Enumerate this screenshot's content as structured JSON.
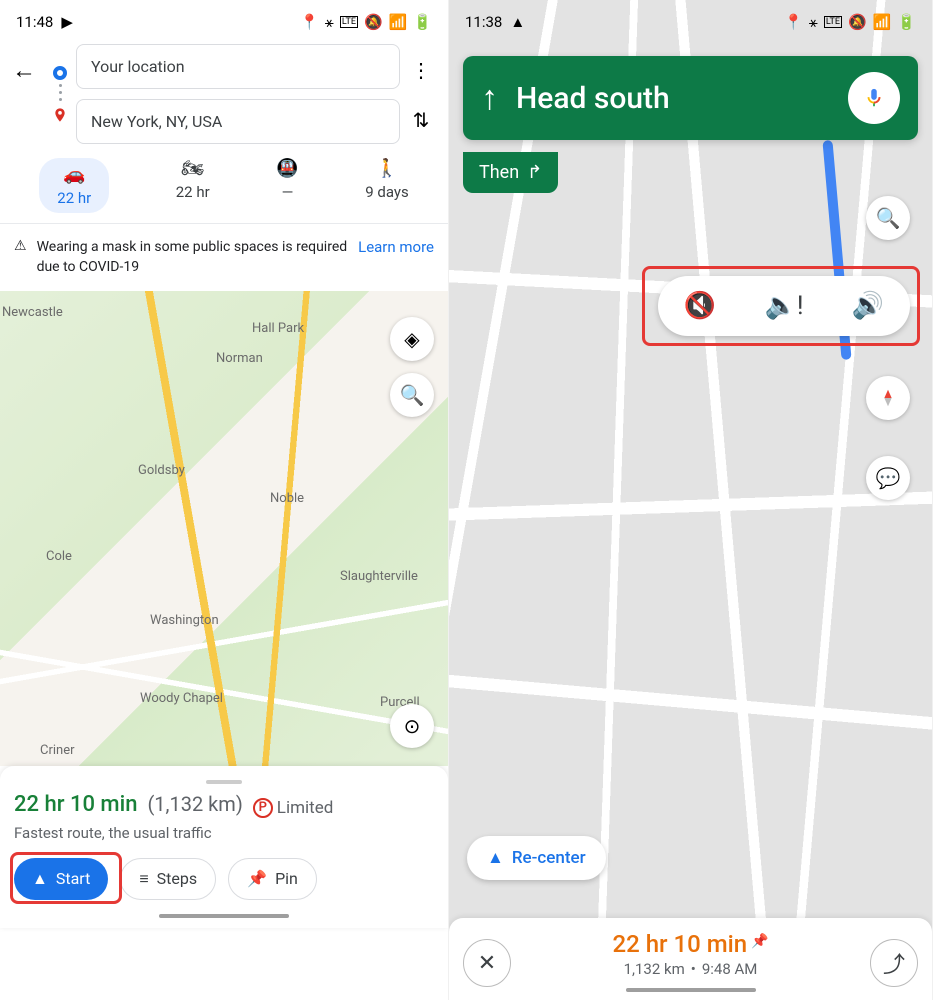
{
  "left": {
    "status": {
      "time": "11:48"
    },
    "origin": "Your location",
    "destination": "New York, NY, USA",
    "modes": {
      "car": "22 hr",
      "moto": "22 hr",
      "transit": "—",
      "walk": "9 days"
    },
    "alert": {
      "text": "Wearing a mask in some public spaces is required due to COVID-19",
      "link": "Learn more"
    },
    "map_labels": {
      "l1": "Newcastle",
      "l2": "Hall Park",
      "l3": "Norman",
      "l4": "Goldsby",
      "l5": "Noble",
      "l6": "Cole",
      "l7": "Slaughterville",
      "l8": "Washington",
      "l9": "Woody Chapel",
      "l10": "Purcell",
      "l11": "Criner"
    },
    "route": {
      "duration": "22 hr 10 min",
      "distance": "(1,132 km)",
      "parking_label": "Limited",
      "note": "Fastest route, the usual traffic"
    },
    "buttons": {
      "start": "Start",
      "steps": "Steps",
      "pin": "Pin"
    }
  },
  "right": {
    "status": {
      "time": "11:38"
    },
    "nav_instruction": "Head south",
    "then": "Then",
    "recenter": "Re-center",
    "eta": {
      "duration": "22 hr 10 min",
      "distance": "1,132 km",
      "arrival": "9:48 AM"
    }
  }
}
